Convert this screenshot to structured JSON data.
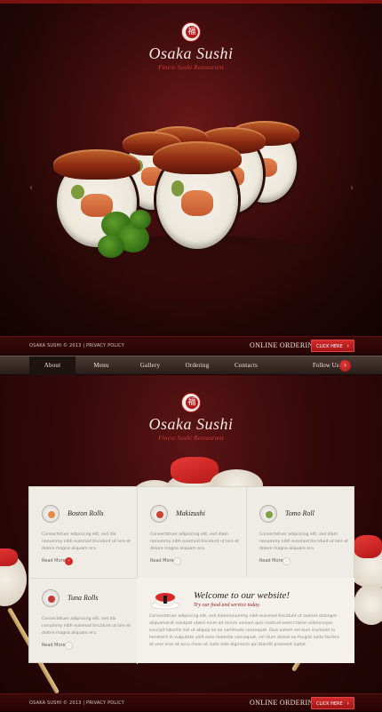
{
  "brand": {
    "name": "Osaka Sushi",
    "tagline": "Finest Sushi Restaurant",
    "mark": "福"
  },
  "hero": {
    "prev_arrow": "‹",
    "next_arrow": "›"
  },
  "footer_bar": {
    "copyright": "OSAKA SUSHI © 2013 | PRIVACY POLICY",
    "ordering_label": "ONLINE ORDERING",
    "button_label": "CLICK HERE",
    "button_chevron": "›"
  },
  "nav": {
    "items": [
      {
        "label": "About",
        "active": true
      },
      {
        "label": "Menu",
        "active": false
      },
      {
        "label": "Gallery",
        "active": false
      },
      {
        "label": "Ordering",
        "active": false
      },
      {
        "label": "Contacts",
        "active": false
      }
    ],
    "follow_label": "Follow Us",
    "follow_icon": "›"
  },
  "cards": [
    {
      "title": "Boston Rolls",
      "text": "Consectetuer adipiscing elit, sed dia nonummy nibh euismod tincidunt ut lore et dolore magna aliquam era.",
      "read_more": "Read More",
      "dot_color": "#d82828"
    },
    {
      "title": "Makizushi",
      "text": "Consectetuer adipiscing elit, sed diam nonummy nibh euismod tincidunt ut lore et dolore magna aliquam era.",
      "read_more": "Read More",
      "dot_color": "#ffffff"
    },
    {
      "title": "Tomo Roll",
      "text": "Consectetuer adipiscing elit, sed diam nonummy nibh euismod tincidunt ut lore et dolore magna aliquam era.",
      "read_more": "Read More",
      "dot_color": "#ffffff"
    },
    {
      "title": "Tuna Rolls",
      "text": "Consectetuer adipiscing elit, sed dia nonummy nibh euismod tincidunt ut lore et dolore magna aliquam era.",
      "read_more": "Read More",
      "dot_color": "#ffffff"
    }
  ],
  "welcome": {
    "title": "Welcome to our website!",
    "subtitle": "Try our food and service today.",
    "text": "Consectetuer adipiscing elit, sed diamnonummy nibh euismod tincidunt ut laoreet dolongre aliquamerat volutpat utwisi enim ad minim veniam quis nostrud exerci tation ullamcorper suscipit lobortis nisl ut aliquip ex ea commodo consequat. Duis autem vel eum iriureolor in hendrerit in vulputate velit esse molestie consequat, vel illum dolore eu feugiat nulla facilisis at vero eros et accu msan et iusto odio dignissim qui blandit praesent luptat."
  },
  "colors": {
    "accent_red": "#c41e1e",
    "dark_maroon": "#2a0606",
    "panel_bg": "#efece6"
  }
}
